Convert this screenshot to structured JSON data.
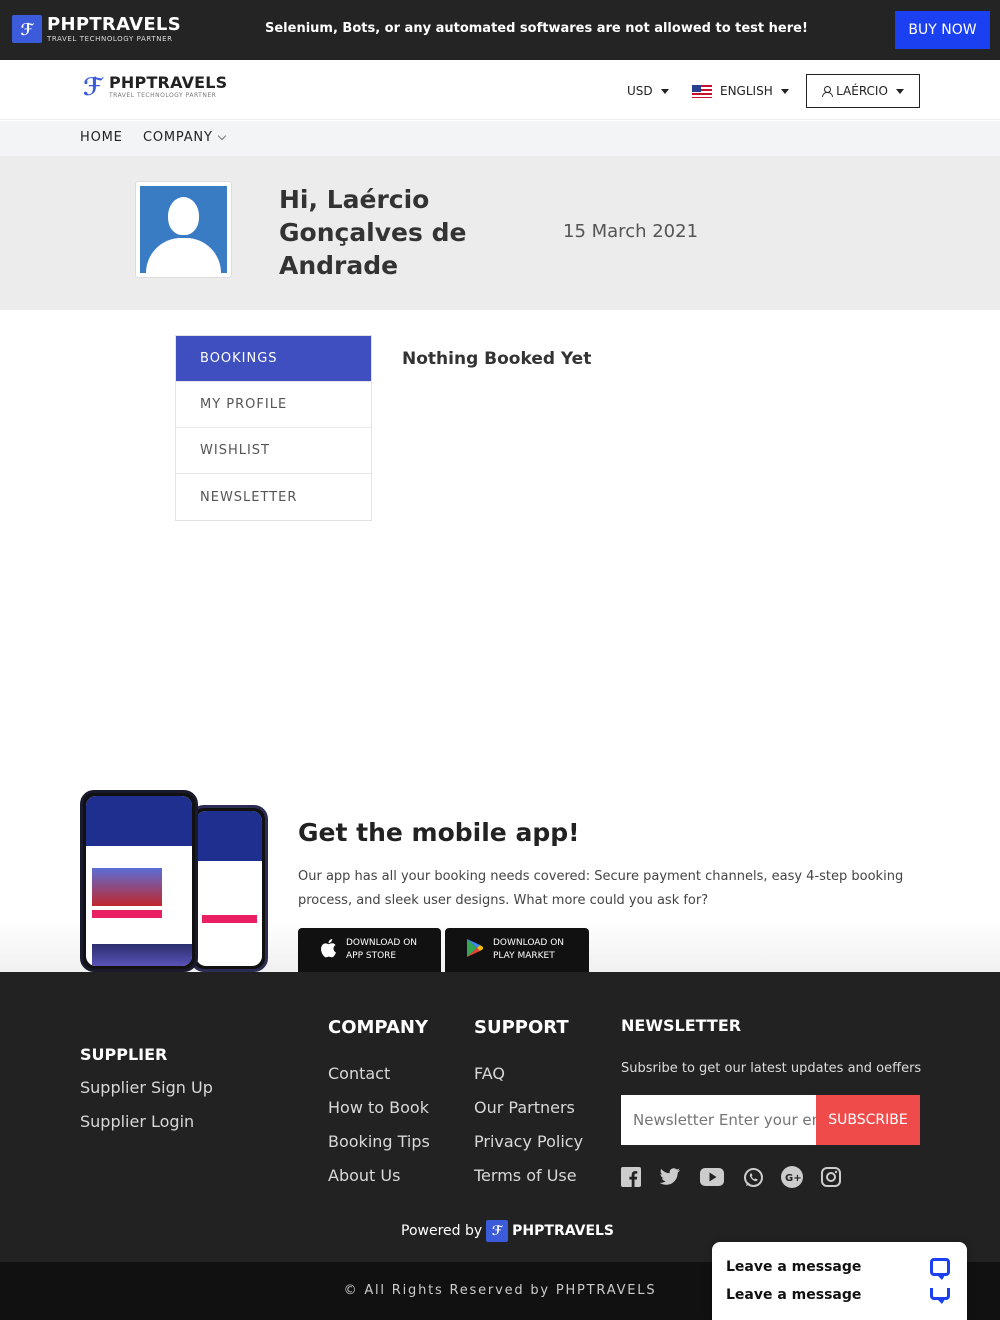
{
  "topbar": {
    "logo_name": "PHPTRAVELS",
    "logo_tagline": "TRAVEL TECHNOLOGY PARTNER",
    "warning": "Selenium, Bots, or any automated softwares are not allowed to test here!",
    "buy_now": "BUY NOW"
  },
  "header": {
    "logo_name": "PHPTRAVELS",
    "logo_tagline": "TRAVEL TECHNOLOGY PARTNER",
    "currency": "USD",
    "language": "ENGLISH",
    "user": "LAÉRCIO"
  },
  "nav": {
    "home": "HOME",
    "company": "COMPANY"
  },
  "profile": {
    "greeting": "Hi, Laércio Gonçalves de Andrade",
    "date": "15 March 2021"
  },
  "sidebar": {
    "items": [
      {
        "label": "BOOKINGS",
        "active": true
      },
      {
        "label": "MY PROFILE",
        "active": false
      },
      {
        "label": "WISHLIST",
        "active": false
      },
      {
        "label": "NEWSLETTER",
        "active": false
      }
    ]
  },
  "bookings": {
    "empty_text": "Nothing Booked Yet"
  },
  "app_promo": {
    "title": "Get the mobile app!",
    "text": "Our app has all your booking needs covered: Secure payment channels, easy 4-step booking process, and sleek user designs. What more could you ask for?",
    "apple_line1": "DOWNLOAD ON",
    "apple_line2": "APP STORE",
    "play_line1": "DOWNLOAD ON",
    "play_line2": "PLAY MARKET"
  },
  "footer": {
    "supplier": {
      "title": "SUPPLIER",
      "links": [
        "Supplier Sign Up",
        "Supplier Login"
      ]
    },
    "company": {
      "title": "COMPANY",
      "links": [
        "Contact",
        "How to Book",
        "Booking Tips",
        "About Us"
      ]
    },
    "support": {
      "title": "SUPPORT",
      "links": [
        "FAQ",
        "Our Partners",
        "Privacy Policy",
        "Terms of Use"
      ]
    },
    "newsletter": {
      "title": "NEWSLETTER",
      "subtitle": "Subsribe to get our latest updates and oeffers",
      "placeholder": "Newsletter Enter your email",
      "button": "SUBSCRIBE"
    },
    "social": [
      "facebook-icon",
      "twitter-icon",
      "youtube-icon",
      "whatsapp-icon",
      "google-plus-icon",
      "instagram-icon"
    ],
    "powered_by": "Powered by",
    "powered_name": "PHPTRAVELS",
    "copyright": "© All Rights Reserved by PHPTRAVELS"
  },
  "chat": {
    "line1": "Leave a message",
    "line2": "Leave a message"
  },
  "colors": {
    "accent": "#3f4fbf",
    "buy_button": "#1a40f2",
    "subscribe": "#f04b4b",
    "footer_bg": "#222222"
  }
}
